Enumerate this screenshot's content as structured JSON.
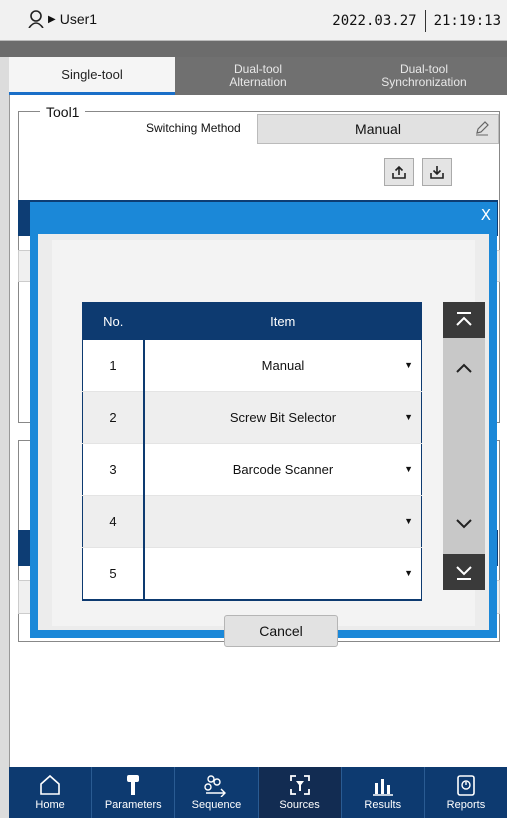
{
  "status_bar": {
    "user": "User1",
    "date": "2022.03.27",
    "time": "21:19:13"
  },
  "tabs": [
    {
      "label": "Single-tool",
      "active": true
    },
    {
      "label": "Dual-tool\nAlternation",
      "active": false
    },
    {
      "label": "Dual-tool\nSynchronization",
      "active": false
    }
  ],
  "tool_section": {
    "legend": "Tool1",
    "switching_label": "Switching Method",
    "switching_value": "Manual"
  },
  "modal": {
    "close": "X",
    "headers": {
      "no": "No.",
      "item": "Item"
    },
    "rows": [
      {
        "no": "1",
        "item": "Manual"
      },
      {
        "no": "2",
        "item": "Screw Bit Selector"
      },
      {
        "no": "3",
        "item": "Barcode Scanner"
      },
      {
        "no": "4",
        "item": ""
      },
      {
        "no": "5",
        "item": ""
      }
    ],
    "cancel": "Cancel"
  },
  "nav": [
    {
      "label": "Home",
      "icon": "home-icon"
    },
    {
      "label": "Parameters",
      "icon": "wrench-icon"
    },
    {
      "label": "Sequence",
      "icon": "sequence-icon"
    },
    {
      "label": "Sources",
      "icon": "sources-icon",
      "active": true
    },
    {
      "label": "Results",
      "icon": "results-icon"
    },
    {
      "label": "Reports",
      "icon": "reports-icon"
    }
  ],
  "colors": {
    "accent": "#1b88d8",
    "navy": "#0d3a70"
  }
}
